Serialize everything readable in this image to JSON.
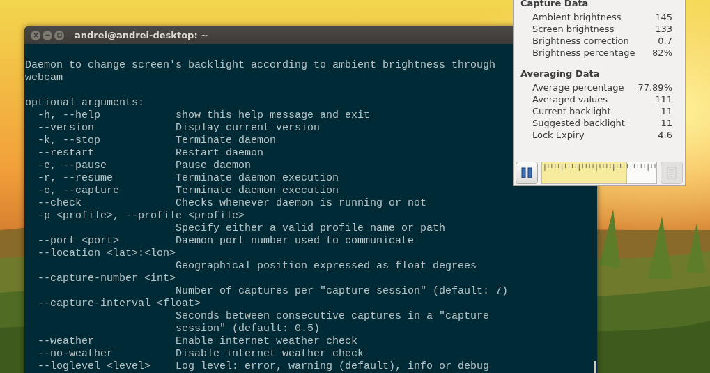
{
  "terminal": {
    "title": "andrei@andrei-desktop: ~",
    "intro": [
      "Daemon to change screen's backlight according to ambient brightness through",
      "webcam"
    ],
    "section": "optional arguments:",
    "options": [
      {
        "option": "-h, --help",
        "description": "show this help message and exit"
      },
      {
        "option": "--version",
        "description": "Display current version"
      },
      {
        "option": "-k, --stop",
        "description": "Terminate daemon"
      },
      {
        "option": "--restart",
        "description": "Restart daemon"
      },
      {
        "option": "-e, --pause",
        "description": "Pause daemon"
      },
      {
        "option": "-r, --resume",
        "description": "Terminate daemon execution"
      },
      {
        "option": "-c, --capture",
        "description": "Terminate daemon execution"
      },
      {
        "option": "--check",
        "description": "Checks whenever daemon is running or not"
      },
      {
        "option": "-p <profile>, --profile <profile>"
      },
      {
        "description": "Specify either a valid profile name or path"
      },
      {
        "option": "--port <port>",
        "description": "Daemon port number used to communicate"
      },
      {
        "option": "--location <lat>:<lon>"
      },
      {
        "description": "Geographical position expressed as float degrees"
      },
      {
        "option": "--capture-number <int>"
      },
      {
        "description": "Number of captures per \"capture session\" (default: 7)"
      },
      {
        "option": "--capture-interval <float>"
      },
      {
        "description": "Seconds between consecutive captures in a \"capture"
      },
      {
        "description": "session\" (default: 0.5)"
      },
      {
        "option": "--weather",
        "description": "Enable internet weather check"
      },
      {
        "option": "--no-weather",
        "description": "Disable internet weather check"
      },
      {
        "option": "--loglevel <level>",
        "description": "Log level: error, warning (default), info or debug"
      }
    ]
  },
  "panel": {
    "sections": [
      {
        "heading": "Capture Data",
        "rows": [
          {
            "label": "Ambient brightness",
            "value": "145"
          },
          {
            "label": "Screen brightness",
            "value": "133"
          },
          {
            "label": "Brightness correction",
            "value": "0.7"
          },
          {
            "label": "Brightness percentage",
            "value": "82%"
          }
        ]
      },
      {
        "heading": "Averaging Data",
        "rows": [
          {
            "label": "Average percentage",
            "value": "77.89%"
          },
          {
            "label": "Averaged values",
            "value": "111"
          },
          {
            "label": "Current backlight",
            "value": "11"
          },
          {
            "label": "Suggested backlight",
            "value": "11"
          },
          {
            "label": "Lock Expiry",
            "value": "4.6"
          }
        ]
      }
    ],
    "slider": {
      "level": 0.74
    },
    "pause_button": {
      "disabled": false
    },
    "doc_button": {
      "disabled": true
    }
  }
}
